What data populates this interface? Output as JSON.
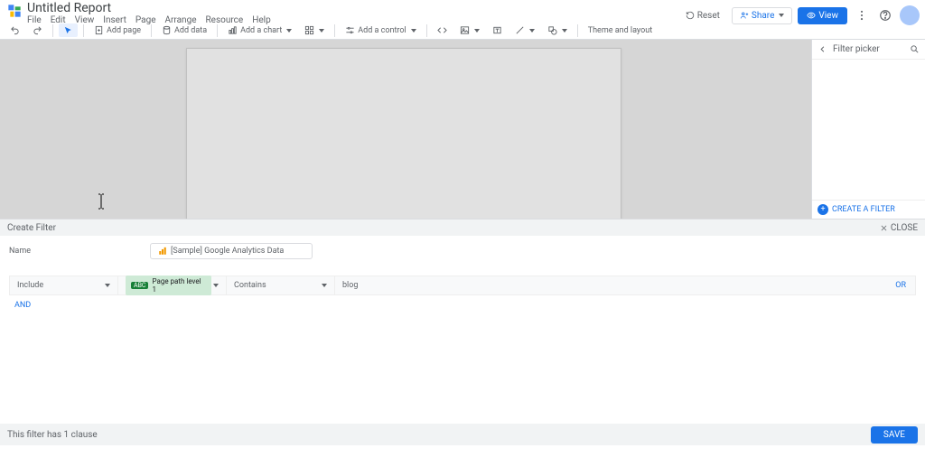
{
  "doc": {
    "title": "Untitled Report"
  },
  "menu": {
    "file": "File",
    "edit": "Edit",
    "view": "View",
    "insert": "Insert",
    "page": "Page",
    "arrange": "Arrange",
    "resource": "Resource",
    "help": "Help"
  },
  "header_actions": {
    "reset": "Reset",
    "share": "Share",
    "view": "View"
  },
  "toolbar": {
    "add_page": "Add page",
    "add_data": "Add data",
    "add_chart": "Add a chart",
    "add_control": "Add a control",
    "theme": "Theme and layout"
  },
  "sidebar": {
    "title": "Filter picker",
    "create_filter": "CREATE A FILTER"
  },
  "editor": {
    "title": "Create Filter",
    "close": "CLOSE",
    "name_label": "Name",
    "data_source": "[Sample] Google Analytics Data",
    "clause": {
      "mode": "Include",
      "field_badge": "ABC",
      "field": "Page path level 1",
      "condition": "Contains",
      "value": "blog",
      "or": "OR",
      "and": "AND"
    },
    "footer_status": "This filter has 1 clause",
    "save": "SAVE"
  }
}
